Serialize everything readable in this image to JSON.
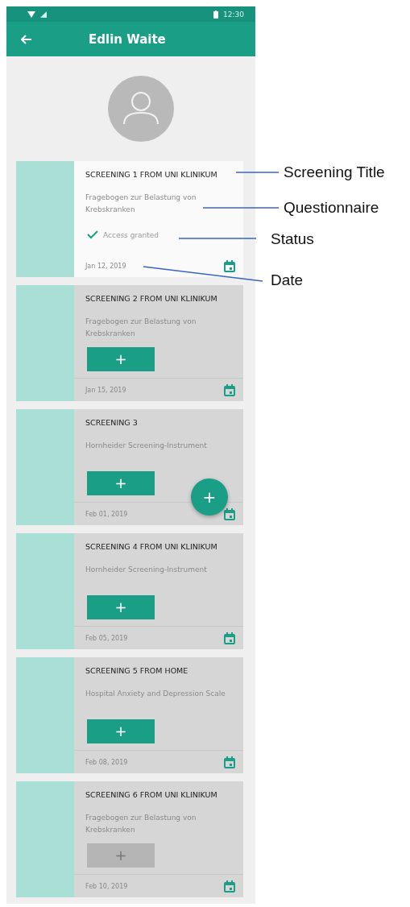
{
  "status_bar": {
    "time": "12:30"
  },
  "app_bar": {
    "title": "Edlin Waite"
  },
  "cards": [
    {
      "kind": "status",
      "title": "SCREENING 1 FROM UNI KLINIKUM",
      "questionnaire": "Fragebogen zur Belastung von Krebskranken",
      "status": "Access granted",
      "date": "Jan 12, 2019"
    },
    {
      "kind": "button",
      "title": "SCREENING 2 FROM UNI KLINIKUM",
      "questionnaire": "Fragebogen zur Belastung von Krebskranken",
      "button": "+",
      "disabled": false,
      "date": "Jan 15, 2019"
    },
    {
      "kind": "button",
      "title": "SCREENING 3",
      "questionnaire": "Hornheider Screening-Instrument",
      "button": "+",
      "disabled": false,
      "date": "Feb 01, 2019"
    },
    {
      "kind": "button",
      "title": "SCREENING 4 FROM UNI KLINIKUM",
      "questionnaire": "Hornheider Screening-Instrument",
      "button": "+",
      "disabled": false,
      "date": "Feb 05, 2019"
    },
    {
      "kind": "button",
      "title": "SCREENING 5 FROM HOME",
      "questionnaire": "Hospital Anxiety and Depression Scale",
      "button": "+",
      "disabled": false,
      "date": "Feb 08, 2019"
    },
    {
      "kind": "button",
      "title": "SCREENING 6 FROM UNI KLINIKUM",
      "questionnaire": "Fragebogen zur Belastung von Krebskranken",
      "button": "+",
      "disabled": true,
      "date": "Feb 10, 2019"
    }
  ],
  "fab": {
    "label": "+"
  },
  "annotations": [
    "Screening Title",
    "Questionnaire",
    "Status",
    "Date"
  ]
}
